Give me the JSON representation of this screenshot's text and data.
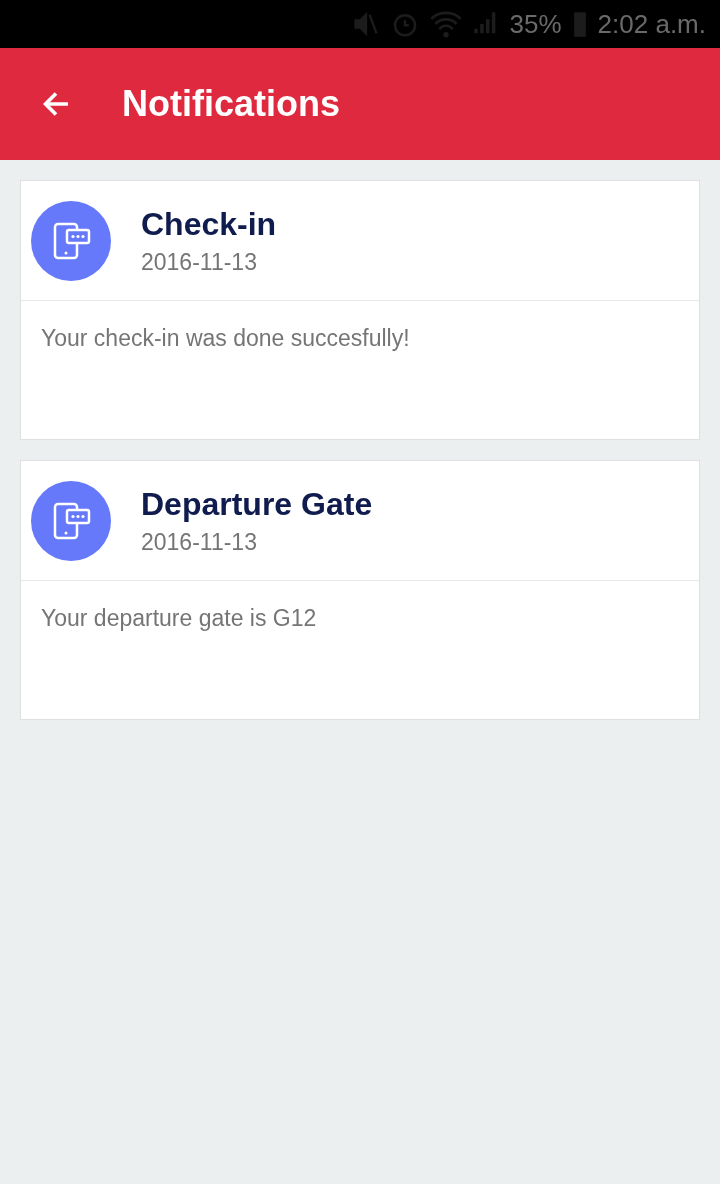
{
  "status_bar": {
    "battery": "35%",
    "time": "2:02 a.m."
  },
  "app_bar": {
    "title": "Notifications"
  },
  "notifications": [
    {
      "title": "Check-in",
      "date": "2016-11-13",
      "message": "Your check-in was done succesfully!"
    },
    {
      "title": "Departure Gate",
      "date": "2016-11-13",
      "message": "Your departure gate is G12"
    }
  ]
}
